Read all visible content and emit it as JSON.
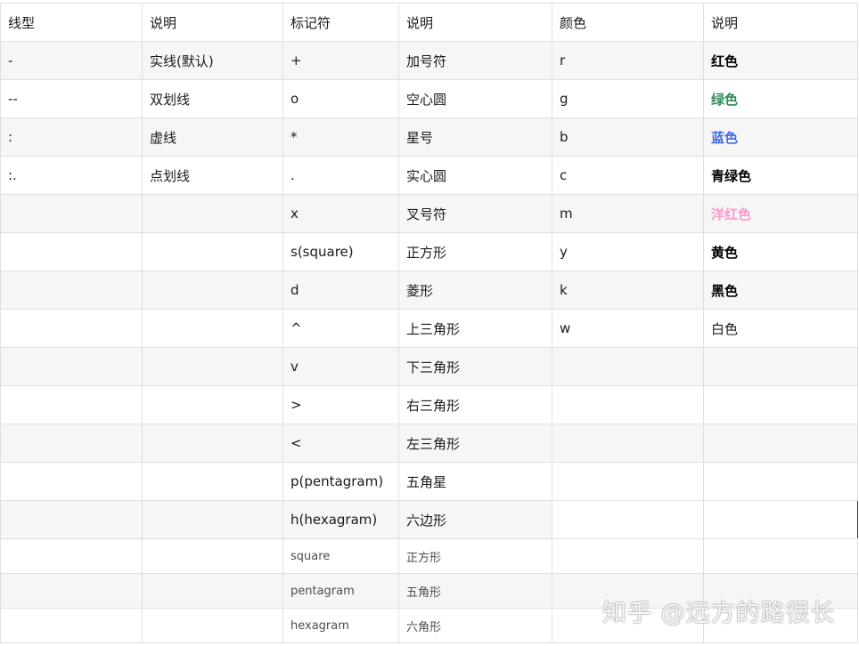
{
  "header": [
    "线型",
    "说明",
    "标记符",
    "说明",
    "颜色",
    "说明"
  ],
  "rows": [
    [
      "-",
      "实线(默认)",
      "+",
      "加号符",
      "r",
      "红色"
    ],
    [
      "--",
      "双划线",
      "o",
      "空心圆",
      "g",
      "绿色"
    ],
    [
      ":",
      "虚线",
      "*",
      "星号",
      "b",
      "蓝色"
    ],
    [
      ":.",
      "点划线",
      ".",
      "实心圆",
      "c",
      "青绿色"
    ],
    [
      "",
      "",
      "x",
      "叉号符",
      "m",
      "洋红色"
    ],
    [
      "",
      "",
      "s(square)",
      "正方形",
      "y",
      "黄色"
    ],
    [
      "",
      "",
      "d",
      "菱形",
      "k",
      "黑色"
    ],
    [
      "",
      "",
      "^",
      "上三角形",
      "w",
      "白色"
    ],
    [
      "",
      "",
      "v",
      "下三角形",
      "",
      ""
    ],
    [
      "",
      "",
      ">",
      "右三角形",
      "",
      ""
    ],
    [
      "",
      "",
      "<",
      "左三角形",
      "",
      ""
    ],
    [
      "",
      "",
      "p(pentagram)",
      "五角星",
      "",
      ""
    ],
    [
      "",
      "",
      "h(hexagram)",
      "六边形",
      "",
      ""
    ],
    [
      "",
      "",
      "square",
      "正方形",
      "",
      ""
    ],
    [
      "",
      "",
      "pentagram",
      "五角形",
      "",
      ""
    ],
    [
      "",
      "",
      "hexagram",
      "六角形",
      "",
      ""
    ]
  ],
  "color_styles": {
    "红色": "#000000",
    "绿色": "#2e8b57",
    "蓝色": "#4169e1",
    "青绿色": "#000000",
    "洋红色": "#ff99cc",
    "黄色": "#000000",
    "黑色": "#000000",
    "白色": "#1a1a1a"
  },
  "watermark": "知乎 @远方的路很长"
}
